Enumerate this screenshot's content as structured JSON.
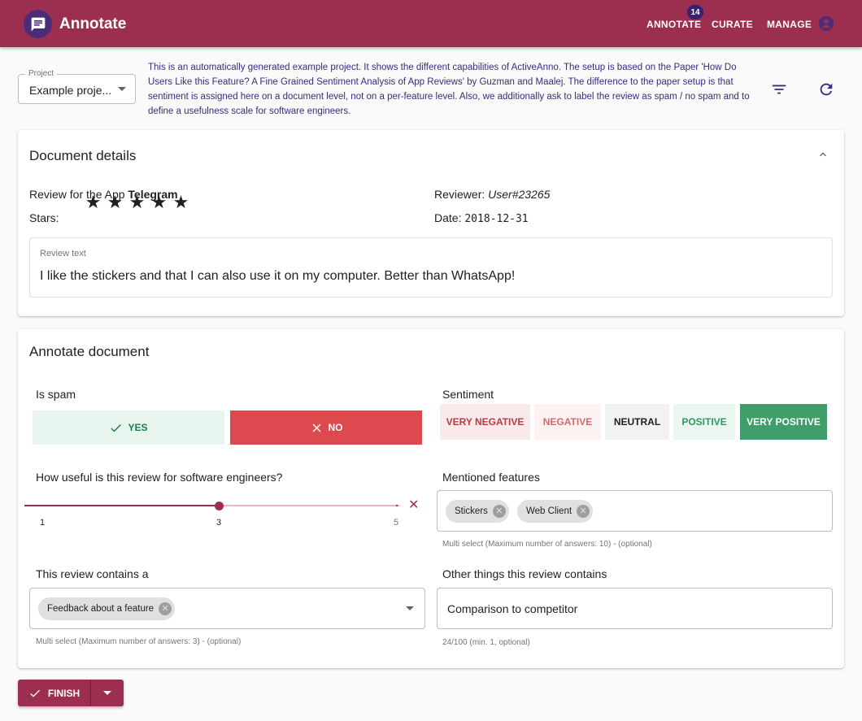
{
  "app": {
    "title": "Annotate",
    "nav": [
      {
        "label": "ANNOTATE",
        "badge": "14"
      },
      {
        "label": "CURATE"
      },
      {
        "label": "MANAGE"
      }
    ],
    "colors": {
      "primary": "#9c2f50",
      "secondary": "#4a2c78"
    }
  },
  "project": {
    "label": "Project",
    "value": "Example proje...",
    "description": "This is an automatically generated example project. It shows the different capabilities of ActiveAnno. The setup is based on the Paper 'How Do Users Like this Feature? A Fine Grained Sentiment Analysis of App Reviews' by Guzman and Maalej. The difference to the paper setup is that sentiment is assigned here on a document level, not on a per-feature level. Also, we additionally ask to label the review as spam / no spam and to define a usefulness scale for software engineers.",
    "icons": [
      "filter-icon",
      "refresh-icon"
    ]
  },
  "document": {
    "title": "Document details",
    "review_for_prefix": "Review for the App",
    "app_name": "Telegram",
    "stars_label": "Stars:",
    "stars": 5,
    "reviewer_label": "Reviewer:",
    "reviewer": "User#23265",
    "date_label": "Date:",
    "date": "2018-12-31",
    "review_text_label": "Review text",
    "review_text": "I like the stickers and that I can also use it on my computer. Better than WhatsApp!"
  },
  "annotate": {
    "title": "Annotate document",
    "spam": {
      "label": "Is spam",
      "yes": "YES",
      "no": "NO",
      "selected": "NO"
    },
    "sentiment": {
      "label": "Sentiment",
      "options": [
        "VERY NEGATIVE",
        "NEGATIVE",
        "NEUTRAL",
        "POSITIVE",
        "VERY POSITIVE"
      ],
      "selected": "VERY POSITIVE"
    },
    "usefulness": {
      "label": "How useful is this review for software engineers?",
      "min": "1",
      "value": "3",
      "max": "5"
    },
    "features": {
      "label": "Mentioned features",
      "chips": [
        "Stickers",
        "Web Client"
      ],
      "helper": "Multi select (Maximum number of answers: 10) - (optional)"
    },
    "contains": {
      "label": "This review contains a",
      "chips": [
        "Feedback about a feature"
      ],
      "helper": "Multi select (Maximum number of answers: 3) - (optional)"
    },
    "other": {
      "label": "Other things this review contains",
      "value": "Comparison to competitor",
      "helper": "24/100 (min. 1, optional)"
    }
  },
  "finish": {
    "label": "FINISH"
  }
}
